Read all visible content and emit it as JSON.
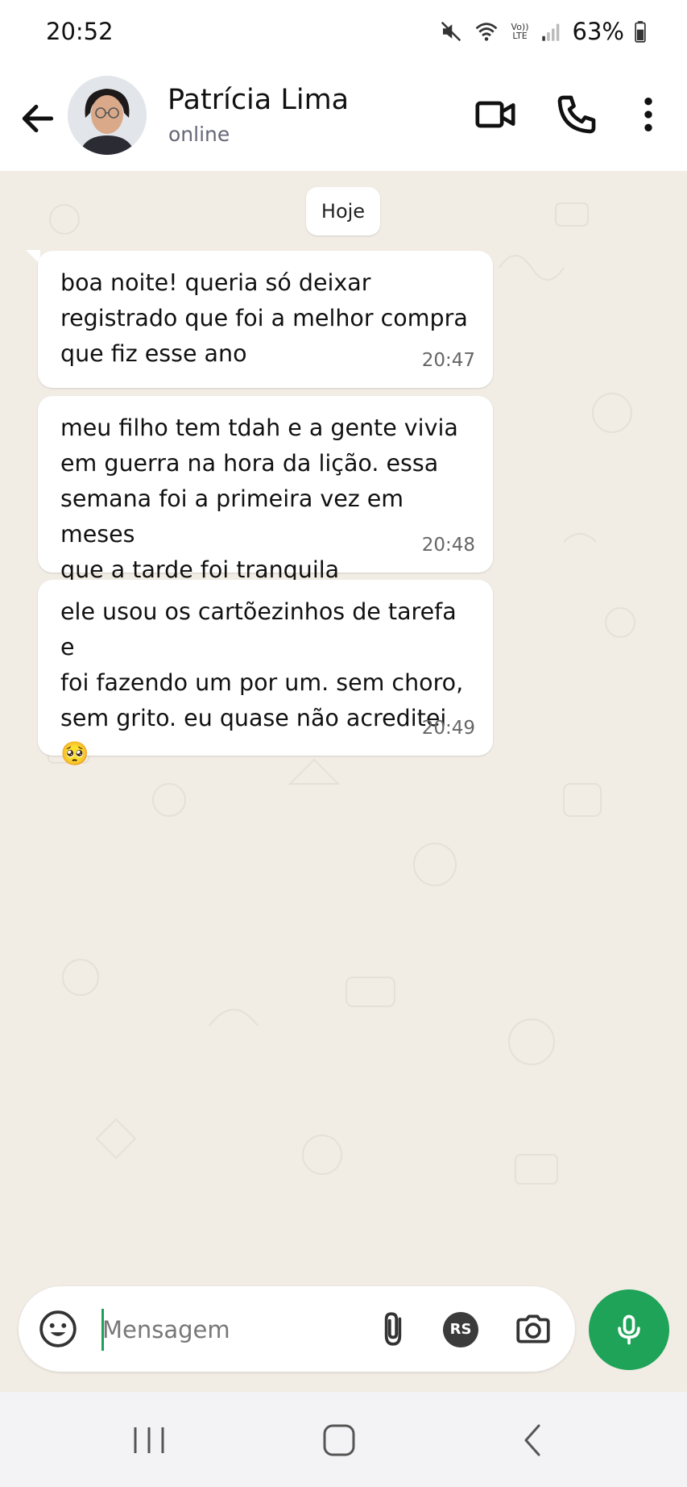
{
  "status_bar": {
    "time": "20:52",
    "lte_label": "Vo)) LTE",
    "battery": "63%",
    "icons": [
      "mute-icon",
      "wifi-icon",
      "lte-icon",
      "signal-icon",
      "battery-icon"
    ]
  },
  "header": {
    "contact_name": "Patrícia Lima",
    "contact_status": "online",
    "icons": [
      "back-arrow-icon",
      "video-call-icon",
      "phone-icon",
      "more-options-icon"
    ]
  },
  "chat": {
    "date_chip": "Hoje",
    "messages": [
      {
        "text": "boa noite! queria só deixar\nregistrado que foi a melhor compra\nque fiz esse ano",
        "time": "20:47"
      },
      {
        "text": "meu filho tem tdah e a gente vivia\nem guerra na hora da lição. essa\nsemana foi a primeira vez em meses\nque a tarde foi tranquila",
        "time": "20:48"
      },
      {
        "text": "ele usou os cartõezinhos de tarefa e\nfoi fazendo um por um. sem choro,\nsem grito. eu quase não acreditei 🥺",
        "time": "20:49"
      }
    ]
  },
  "composer": {
    "placeholder": "Mensagem",
    "rs_badge": "RS",
    "icons": [
      "emoji-icon",
      "attach-icon",
      "rs-payment-icon",
      "camera-icon",
      "mic-icon"
    ]
  },
  "colors": {
    "accent": "#1fa358",
    "chat_background": "#f1ece4",
    "bubble": "#ffffff"
  }
}
